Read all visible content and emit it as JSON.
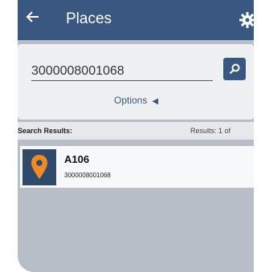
{
  "appbar": {
    "title": "Places",
    "back_icon": "back-arrow-icon",
    "settings_icon": "gear-icon",
    "color": "#3a5782"
  },
  "search": {
    "value": "3000008001068",
    "button_icon": "search-icon",
    "options_label": "Options",
    "options_icon": "triangle-left-icon"
  },
  "results": {
    "label": "Search Results:",
    "count_text": "Results:  1  of"
  },
  "items": [
    {
      "name": "A106",
      "code": "3000008001068",
      "icon": "map-pin-icon",
      "icon_color": "#f08a24"
    }
  ]
}
